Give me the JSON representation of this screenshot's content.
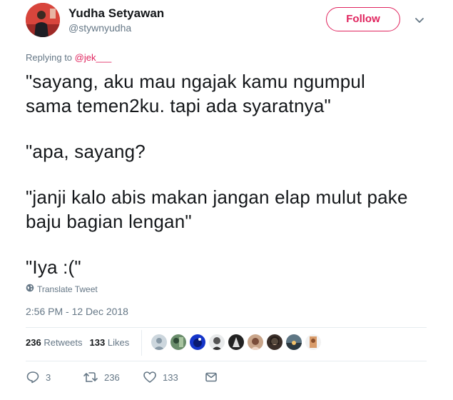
{
  "author": {
    "name": "Yudha Setyawan",
    "handle": "@stywnyudha"
  },
  "follow_label": "Follow",
  "reply": {
    "prefix": "Replying to",
    "mention": "@jek___"
  },
  "body_paragraphs": [
    "\"sayang, aku mau ngajak kamu ngumpul\nsama temen2ku. tapi ada syaratnya\"",
    "\"apa, sayang?",
    "\"janji kalo abis makan jangan elap mulut pake\nbaju bagian lengan\"",
    "\"Iya :(\""
  ],
  "translate_label": "Translate Tweet",
  "timestamp": "2:56 PM - 12 Dec 2018",
  "stats": {
    "retweets_count": "236",
    "retweets_label": "Retweets",
    "likes_count": "133",
    "likes_label": "Likes"
  },
  "actions": {
    "reply_count": "3",
    "retweet_count": "236",
    "like_count": "133"
  },
  "colors": {
    "accent": "#e0245e",
    "secondary_text": "#657786",
    "primary_text": "#14171a"
  },
  "liker_avatar_count": 10
}
